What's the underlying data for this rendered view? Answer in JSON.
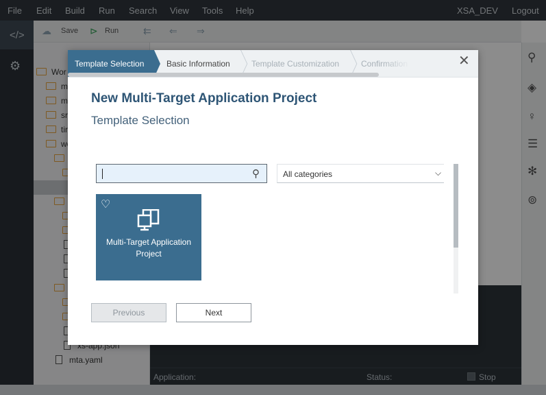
{
  "menu": {
    "items": [
      "File",
      "Edit",
      "Build",
      "Run",
      "Search",
      "View",
      "Tools",
      "Help"
    ],
    "user": "XSA_DEV",
    "logout": "Logout"
  },
  "toolbar": {
    "save": "Save",
    "run": "Run"
  },
  "tree": {
    "rows": [
      {
        "label": "Wor",
        "kind": "folder"
      },
      {
        "label": "m",
        "kind": "folder"
      },
      {
        "label": "m",
        "kind": "folder"
      },
      {
        "label": "sr",
        "kind": "folder"
      },
      {
        "label": "tir",
        "kind": "folder"
      },
      {
        "label": "we",
        "kind": "folder"
      },
      {
        "label": "",
        "kind": "folder"
      },
      {
        "label": "",
        "kind": "folder"
      },
      {
        "label": "",
        "kind": "selected"
      },
      {
        "label": "",
        "kind": "folder"
      },
      {
        "label": "",
        "kind": "folder"
      },
      {
        "label": "",
        "kind": "folder"
      },
      {
        "label": "",
        "kind": "file"
      },
      {
        "label": "",
        "kind": "file"
      },
      {
        "label": "",
        "kind": "file"
      },
      {
        "label": "",
        "kind": "folder"
      },
      {
        "label": "",
        "kind": "folder"
      },
      {
        "label": "",
        "kind": "folder"
      },
      {
        "label": "",
        "kind": "file"
      },
      {
        "label": "xs-app.json",
        "kind": "file"
      },
      {
        "label": "mta.yaml",
        "kind": "file"
      }
    ]
  },
  "status": {
    "application": "Application:",
    "status": "Status:",
    "stop": "Stop"
  },
  "dialog": {
    "steps": [
      "Template Selection",
      "Basic Information",
      "Template Customization",
      "Confirmation"
    ],
    "active_step": "Template Selection",
    "title": "New Multi-Target Application Project",
    "subtitle": "Template Selection",
    "search_placeholder": "",
    "category": "All categories",
    "templates": [
      {
        "name": "Multi-Target Application Project",
        "line1": "Multi-Target Application",
        "line2": "Project"
      }
    ],
    "previous": "Previous",
    "next": "Next"
  },
  "colors": {
    "accent": "#3b6d8f",
    "title": "#2e5575",
    "menubar": "#30363c"
  },
  "icons": {
    "left": [
      "code-icon",
      "gear-icon"
    ],
    "right": [
      "search-icon",
      "git-icon",
      "lightbulb-icon",
      "outline-icon",
      "debug-icon",
      "service-icon"
    ]
  }
}
